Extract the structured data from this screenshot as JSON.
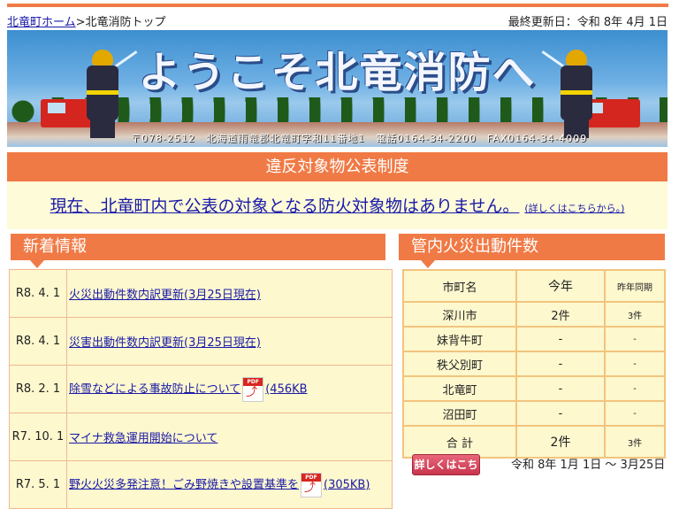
{
  "breadcrumb": {
    "home": "北竜町ホーム",
    "sep": ">",
    "current": "北竜消防トップ"
  },
  "updated": "最終更新日：令和 8年 4月 1日",
  "banner": {
    "title": "ようこそ北竜消防へ",
    "address": "〒078-2512　北海道雨竜郡北竜町字和11番地1　電話0164-34-2200　FAX0164-34-4009"
  },
  "violation": {
    "heading": "違反対象物公表制度",
    "message": "現在、北竜町内で公表の対象となる防火対象物はありません。",
    "link": "(詳しくはこちらから。)"
  },
  "news": {
    "heading": "新着情報",
    "items": [
      {
        "date": "R8. 4. 1",
        "text": "火災出動件数内訳更新(3月25日現在)"
      },
      {
        "date": "R8. 4. 1",
        "text": "災害出動件数内訳更新(3月25日現在)"
      },
      {
        "date": "R8. 2. 1",
        "text": "除雪などによる事故防止について",
        "pdf": true,
        "size": "(456KB"
      },
      {
        "date": "R7. 10. 1",
        "text": "マイナ救急運用開始について"
      },
      {
        "date": "R7. 5. 1",
        "text": "野火火災多発注意！ごみ野焼きや設置基準を",
        "pdf": true,
        "size": "(305KB)"
      }
    ]
  },
  "fire_stats": {
    "heading": "管内火災出動件数",
    "columns": [
      "市町名",
      "今年",
      "昨年同期"
    ],
    "rows": [
      [
        "深川市",
        "2件",
        "3件"
      ],
      [
        "妹背牛町",
        "-",
        "-"
      ],
      [
        "秩父別町",
        "-",
        "-"
      ],
      [
        "北竜町",
        "-",
        "-"
      ],
      [
        "沼田町",
        "-",
        "-"
      ]
    ],
    "total": [
      "合 計",
      "2件",
      "3件"
    ],
    "detail_button": "詳しくはこちら",
    "period": "令和 8年 1月 1日 ～ 3月25日"
  },
  "colors": {
    "accent": "#f07a45",
    "panel": "#fdf8ce",
    "link": "#1a1aa8"
  }
}
